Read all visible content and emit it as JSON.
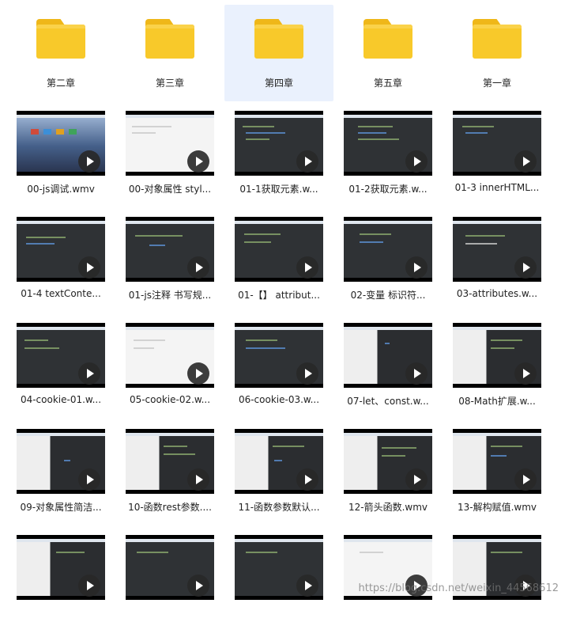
{
  "folders": [
    {
      "name": "第二章"
    },
    {
      "name": "第三章"
    },
    {
      "name": "第四章"
    },
    {
      "name": "第五章"
    },
    {
      "name": "第一章"
    }
  ],
  "videos": [
    {
      "name": "00-js调试.wmv"
    },
    {
      "name": "00-对象属性 styl..."
    },
    {
      "name": "01-1获取元素.w..."
    },
    {
      "name": "01-2获取元素.w..."
    },
    {
      "name": "01-3 innerHTML..."
    },
    {
      "name": "01-4 textConte..."
    },
    {
      "name": "01-js注释 书写规..."
    },
    {
      "name": "01-【】 attribut..."
    },
    {
      "name": "02-变量 标识符..."
    },
    {
      "name": "03-attributes.w..."
    },
    {
      "name": "04-cookie-01.w..."
    },
    {
      "name": "05-cookie-02.w..."
    },
    {
      "name": "06-cookie-03.w..."
    },
    {
      "name": "07-let、const.w..."
    },
    {
      "name": "08-Math扩展.w..."
    },
    {
      "name": "09-对象属性简洁..."
    },
    {
      "name": "10-函数rest参数...."
    },
    {
      "name": "11-函数参数默认..."
    },
    {
      "name": "12-箭头函数.wmv"
    },
    {
      "name": "13-解构赋值.wmv"
    },
    {
      "name": ""
    },
    {
      "name": ""
    },
    {
      "name": ""
    },
    {
      "name": ""
    },
    {
      "name": ""
    }
  ],
  "watermark": "https://blog.csdn.net/weixin_44568612"
}
